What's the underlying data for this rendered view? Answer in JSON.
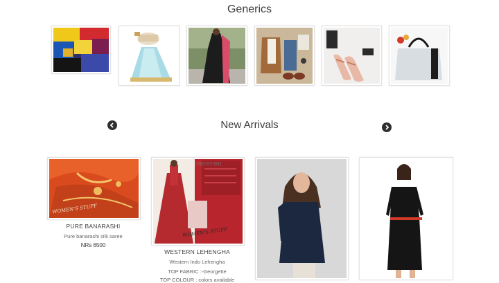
{
  "generics": {
    "title": "Generics",
    "items": [
      {
        "name": "folded-fabrics"
      },
      {
        "name": "lehenga-blouse"
      },
      {
        "name": "dress-dupatta"
      },
      {
        "name": "mens-outfit"
      },
      {
        "name": "sandals"
      },
      {
        "name": "handbag"
      }
    ]
  },
  "new_arrivals": {
    "title": "New Arrivals",
    "prev_icon": "chevron-left-circle-icon",
    "next_icon": "chevron-right-circle-icon",
    "products": [
      {
        "name": "PURE BANARASHI",
        "description": "Pure banarashi silk saree",
        "price": "NRs 6500",
        "watermark": "WOMEN'S STUFF"
      },
      {
        "name": "WESTERN LEHENGHA",
        "description": "Western Indo Lehengha",
        "detail_1": "TOP FABRIC :-Georgette",
        "detail_2": "TOP COLOUR : colors available",
        "watermark": "WOMEN'S STUFF",
        "code": "USD-07-001"
      },
      {
        "name": ""
      },
      {
        "name": ""
      }
    ]
  },
  "colors": {
    "accent_dark": "#2f2f2f",
    "saree_orange": "#d94a1e",
    "lehenga_red": "#b8252c"
  }
}
